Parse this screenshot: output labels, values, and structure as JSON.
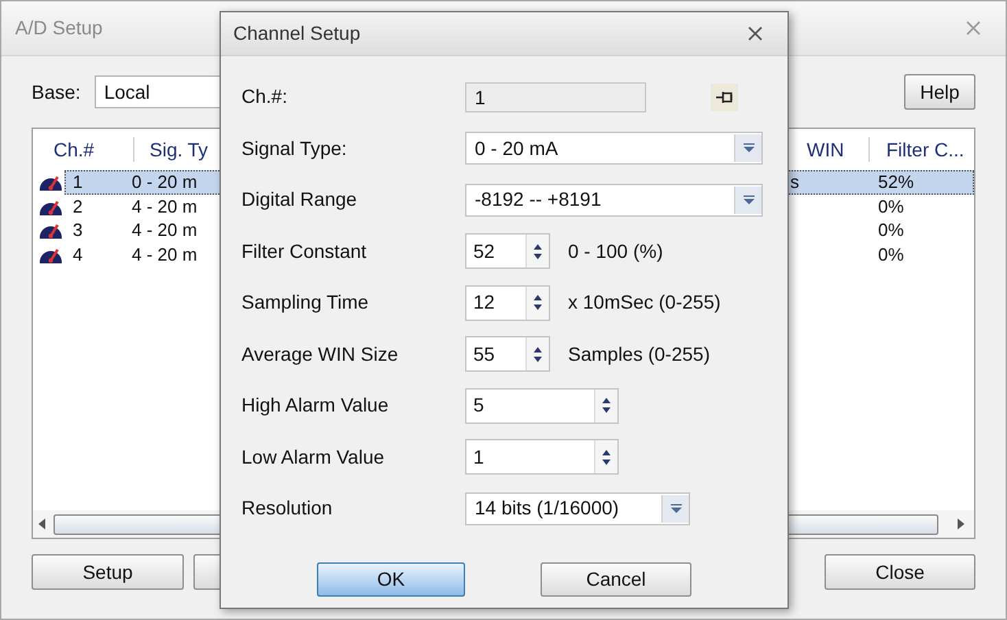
{
  "window": {
    "title": "A/D Setup"
  },
  "base": {
    "label": "Base:",
    "value": "Local"
  },
  "help_button": "Help",
  "channel_list": {
    "columns_left": [
      "Ch.#",
      "Sig. Ty"
    ],
    "columns_right": [
      "WIN",
      "Filter C..."
    ],
    "rows": [
      {
        "channel": "1",
        "signal": "0 - 20 m",
        "win": "s",
        "filter": "52%",
        "selected": true
      },
      {
        "channel": "2",
        "signal": "4 - 20 m",
        "filter": "0%",
        "selected": false
      },
      {
        "channel": "3",
        "signal": "4 - 20 m",
        "filter": "0%",
        "selected": false
      },
      {
        "channel": "4",
        "signal": "4 - 20 m",
        "filter": "0%",
        "selected": false
      }
    ]
  },
  "buttons": [
    "Setup",
    "Close"
  ],
  "dialog": {
    "title": "Channel Setup",
    "fields": [
      {
        "kind": "readonly",
        "label": "Ch.#:",
        "value": "1"
      },
      {
        "kind": "dropdown",
        "label": "Signal Type:",
        "value": "0 - 20 mA"
      },
      {
        "kind": "dropdown",
        "label": "Digital Range",
        "value": "-8192 -- +8191"
      },
      {
        "kind": "spin",
        "label": "Filter Constant",
        "value": "52",
        "unit": "0 - 100 (%)"
      },
      {
        "kind": "spin",
        "label": "Sampling Time",
        "value": "12",
        "unit": "x 10mSec (0-255)"
      },
      {
        "kind": "spin",
        "label": "Average WIN Size",
        "value": "55",
        "unit": "Samples (0-255)"
      },
      {
        "kind": "wide_spin",
        "label": "High Alarm Value",
        "value": "5"
      },
      {
        "kind": "wide_spin",
        "label": "Low Alarm Value",
        "value": "1"
      },
      {
        "kind": "short_dropdown",
        "label": "Resolution",
        "value": "14 bits (1/16000)"
      }
    ],
    "buttons": [
      {
        "label": "OK",
        "default": true
      },
      {
        "label": "Cancel",
        "default": false
      }
    ]
  }
}
